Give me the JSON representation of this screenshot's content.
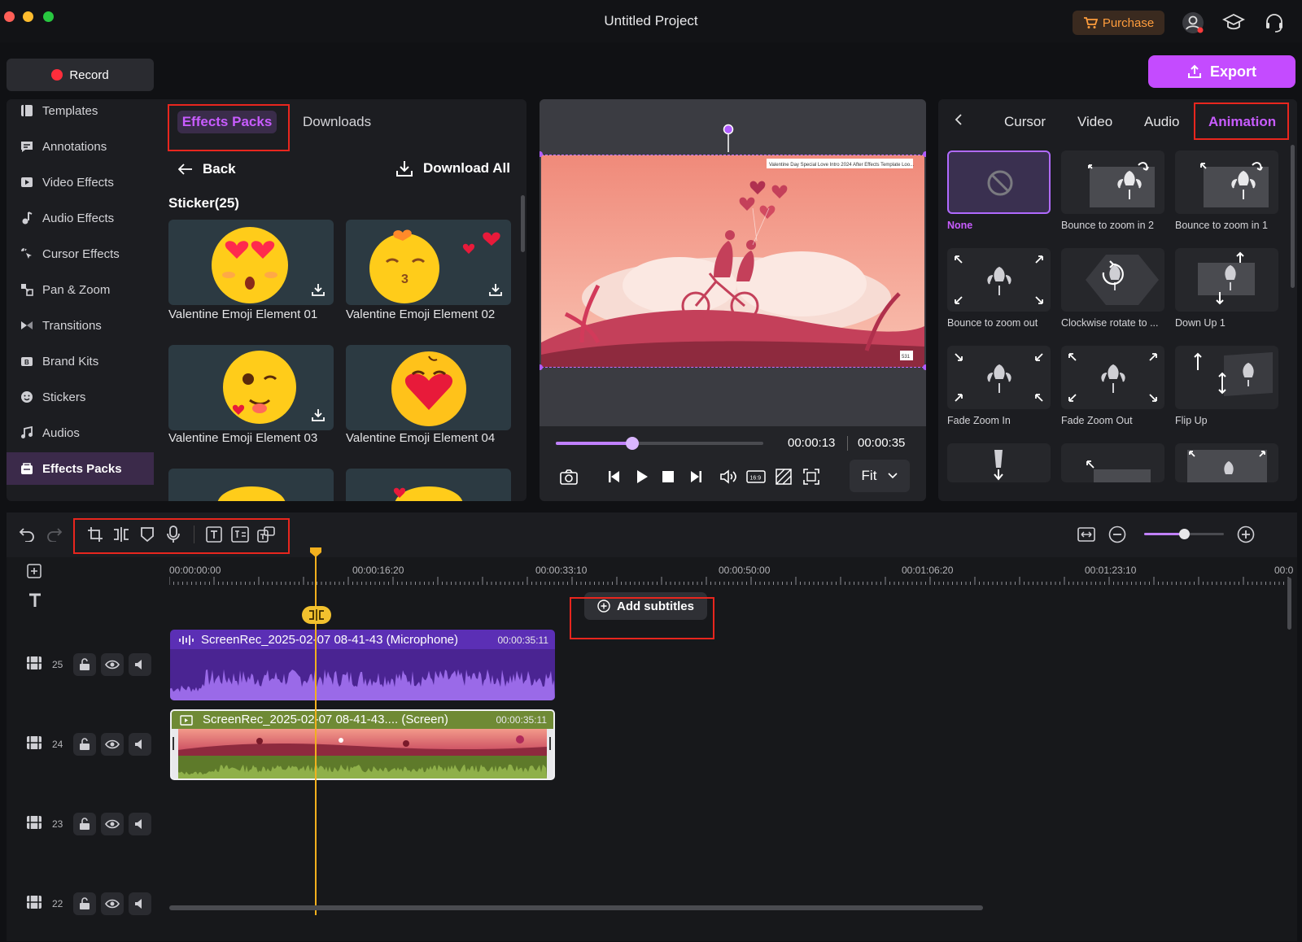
{
  "window": {
    "title": "Untitled Project"
  },
  "header": {
    "purchase_label": "Purchase",
    "record_label": "Record",
    "export_label": "Export"
  },
  "sidebar": {
    "items": [
      {
        "label": "Templates",
        "icon": "templates-icon"
      },
      {
        "label": "Annotations",
        "icon": "annotation-icon"
      },
      {
        "label": "Video Effects",
        "icon": "video-effects-icon"
      },
      {
        "label": "Audio Effects",
        "icon": "audio-effects-icon"
      },
      {
        "label": "Cursor Effects",
        "icon": "cursor-effects-icon"
      },
      {
        "label": "Pan & Zoom",
        "icon": "pan-zoom-icon"
      },
      {
        "label": "Transitions",
        "icon": "transitions-icon"
      },
      {
        "label": "Brand Kits",
        "icon": "brand-kits-icon"
      },
      {
        "label": "Stickers",
        "icon": "stickers-icon"
      },
      {
        "label": "Audios",
        "icon": "audios-icon"
      },
      {
        "label": "Effects Packs",
        "icon": "effects-packs-icon",
        "active": true
      }
    ]
  },
  "library": {
    "tabs": [
      "Effects Packs",
      "Downloads"
    ],
    "back_label": "Back",
    "download_all_label": "Download All",
    "section_title": "Sticker(25)",
    "stickers": [
      {
        "label": "Valentine Emoji Element 01"
      },
      {
        "label": "Valentine Emoji Element 02"
      },
      {
        "label": "Valentine Emoji Element 03"
      },
      {
        "label": "Valentine Emoji Element 04"
      }
    ]
  },
  "preview": {
    "overlay_text": "Valentine Day Special Love Intro 2024 After Effects Template Loo...",
    "corner_badge": "531",
    "progress": 0.37,
    "current_time": "00:00:13",
    "total_time": "00:00:35",
    "fit_label": "Fit",
    "aspect_label": "16:9"
  },
  "animation_panel": {
    "tabs": [
      "Cursor",
      "Video",
      "Audio",
      "Animation"
    ],
    "active_tab": "Animation",
    "items": [
      {
        "label": "None",
        "selected": true
      },
      {
        "label": "Bounce to zoom in 2"
      },
      {
        "label": "Bounce to zoom in 1"
      },
      {
        "label": "Bounce to zoom out"
      },
      {
        "label": "Clockwise rotate to ..."
      },
      {
        "label": "Down Up 1"
      },
      {
        "label": "Fade Zoom In"
      },
      {
        "label": "Fade Zoom Out"
      },
      {
        "label": "Flip Up"
      }
    ]
  },
  "timeline": {
    "ruler": [
      "00:00:00:00",
      "00:00:16:20",
      "00:00:33:10",
      "00:00:50:00",
      "00:01:06:20",
      "00:01:23:10",
      "00:0"
    ],
    "add_subtitles_label": "Add subtitles",
    "zoom_level": 0.5,
    "tracks": [
      {
        "number": "25"
      },
      {
        "number": "24"
      },
      {
        "number": "23"
      },
      {
        "number": "22"
      }
    ],
    "clips": [
      {
        "title": "ScreenRec_2025-02-07 08-41-43 (Microphone)",
        "duration": "00:00:35:11",
        "color": "#5b2fb5"
      },
      {
        "title": "ScreenRec_2025-02-07 08-41-43.... (Screen)",
        "duration": "00:00:35:11",
        "color": "#6f8a35"
      }
    ]
  },
  "colors": {
    "accent": "#c85cff",
    "export": "#c44bff",
    "highlight": "#e8261e",
    "playhead": "#f2b01e"
  }
}
